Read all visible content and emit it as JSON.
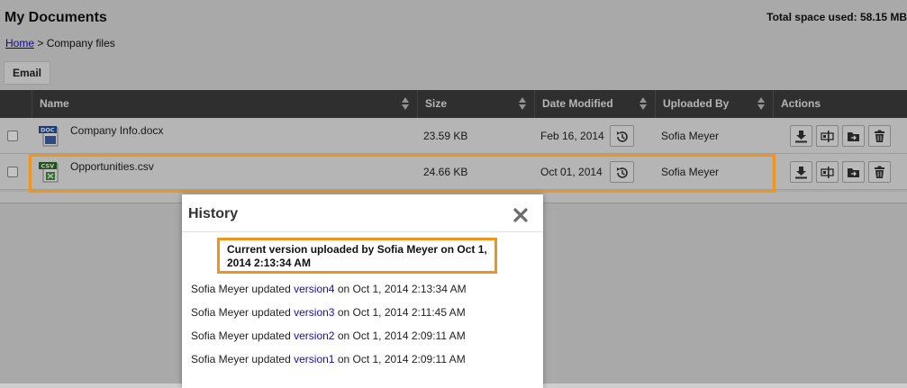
{
  "header": {
    "title": "My Documents",
    "space_used": "Total space used: 58.15 MB"
  },
  "breadcrumb": {
    "home": "Home",
    "separator": ">",
    "current": "Company files"
  },
  "toolbar": {
    "email_label": "Email"
  },
  "table": {
    "columns": [
      "Name",
      "Size",
      "Date Modified",
      "Uploaded By",
      "Actions"
    ],
    "rows": [
      {
        "type_badge": "DOC",
        "name": "Company Info.docx",
        "size": "23.59 KB",
        "date": "Feb 16, 2014",
        "uploaded_by": "Sofia Meyer"
      },
      {
        "type_badge": "CSV",
        "name": "Opportunities.csv",
        "size": "24.66 KB",
        "date": "Oct 01, 2014",
        "uploaded_by": "Sofia Meyer"
      }
    ]
  },
  "history": {
    "title": "History",
    "current_line1": "Current version uploaded by Sofia Meyer on Oct 1,",
    "current_line2": "2014 2:13:34 AM",
    "entries": [
      {
        "user": "Sofia Meyer",
        "action": "updated",
        "version": "version4",
        "when": "on Oct 1, 2014 2:13:34 AM"
      },
      {
        "user": "Sofia Meyer",
        "action": "updated",
        "version": "version3",
        "when": "on Oct 1, 2014 2:11:45 AM"
      },
      {
        "user": "Sofia Meyer",
        "action": "updated",
        "version": "version2",
        "when": "on Oct 1, 2014 2:09:11 AM"
      },
      {
        "user": "Sofia Meyer",
        "action": "updated",
        "version": "version1",
        "when": "on Oct 1, 2014 2:09:11 AM"
      }
    ]
  },
  "colors": {
    "highlight": "#f0941e",
    "header_bg": "#3d3d3d",
    "link": "#1a0dab"
  },
  "icons": {
    "history": "history-icon",
    "download": "download-icon",
    "rename": "rename-icon",
    "move": "move-to-folder-icon",
    "delete": "trash-icon",
    "close": "close-icon"
  }
}
